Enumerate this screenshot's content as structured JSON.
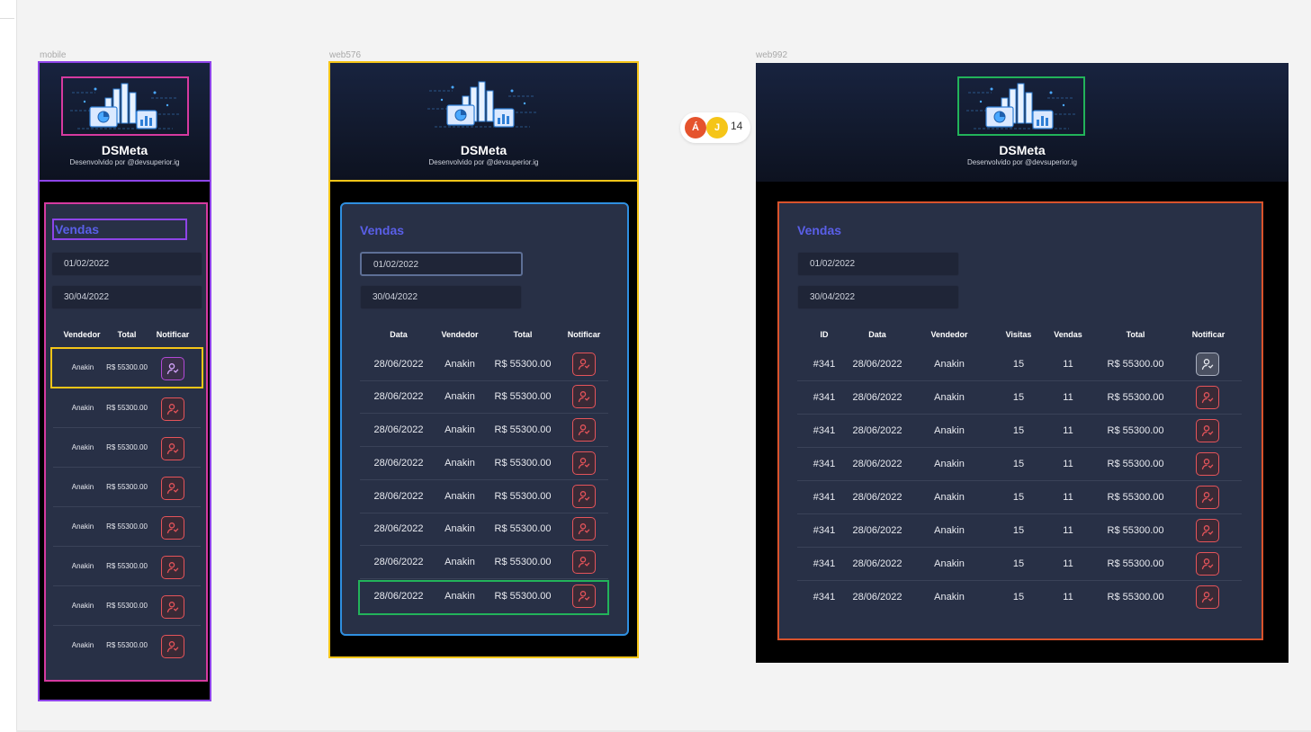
{
  "frames": {
    "mobile_label": "mobile",
    "web576_label": "web576",
    "web992_label": "web992"
  },
  "brand": {
    "title": "DSMeta",
    "subtitle": "Desenvolvido por @devsuperior.ig"
  },
  "sales": {
    "title": "Vendas",
    "date_min": "01/02/2022",
    "date_max": "30/04/2022"
  },
  "columns": {
    "id": "ID",
    "date": "Data",
    "seller": "Vendedor",
    "visits": "Visitas",
    "deals": "Vendas",
    "total": "Total",
    "notify": "Notificar"
  },
  "mobile_rows": [
    {
      "seller": "Anakin",
      "total": "R$ 55300.00"
    },
    {
      "seller": "Anakin",
      "total": "R$ 55300.00"
    },
    {
      "seller": "Anakin",
      "total": "R$ 55300.00"
    },
    {
      "seller": "Anakin",
      "total": "R$ 55300.00"
    },
    {
      "seller": "Anakin",
      "total": "R$ 55300.00"
    },
    {
      "seller": "Anakin",
      "total": "R$ 55300.00"
    },
    {
      "seller": "Anakin",
      "total": "R$ 55300.00"
    },
    {
      "seller": "Anakin",
      "total": "R$ 55300.00"
    }
  ],
  "web576_rows": [
    {
      "date": "28/06/2022",
      "seller": "Anakin",
      "total": "R$ 55300.00"
    },
    {
      "date": "28/06/2022",
      "seller": "Anakin",
      "total": "R$ 55300.00"
    },
    {
      "date": "28/06/2022",
      "seller": "Anakin",
      "total": "R$ 55300.00"
    },
    {
      "date": "28/06/2022",
      "seller": "Anakin",
      "total": "R$ 55300.00"
    },
    {
      "date": "28/06/2022",
      "seller": "Anakin",
      "total": "R$ 55300.00"
    },
    {
      "date": "28/06/2022",
      "seller": "Anakin",
      "total": "R$ 55300.00"
    },
    {
      "date": "28/06/2022",
      "seller": "Anakin",
      "total": "R$ 55300.00"
    },
    {
      "date": "28/06/2022",
      "seller": "Anakin",
      "total": "R$ 55300.00"
    }
  ],
  "web992_rows": [
    {
      "id": "#341",
      "date": "28/06/2022",
      "seller": "Anakin",
      "visits": "15",
      "deals": "11",
      "total": "R$ 55300.00"
    },
    {
      "id": "#341",
      "date": "28/06/2022",
      "seller": "Anakin",
      "visits": "15",
      "deals": "11",
      "total": "R$ 55300.00"
    },
    {
      "id": "#341",
      "date": "28/06/2022",
      "seller": "Anakin",
      "visits": "15",
      "deals": "11",
      "total": "R$ 55300.00"
    },
    {
      "id": "#341",
      "date": "28/06/2022",
      "seller": "Anakin",
      "visits": "15",
      "deals": "11",
      "total": "R$ 55300.00"
    },
    {
      "id": "#341",
      "date": "28/06/2022",
      "seller": "Anakin",
      "visits": "15",
      "deals": "11",
      "total": "R$ 55300.00"
    },
    {
      "id": "#341",
      "date": "28/06/2022",
      "seller": "Anakin",
      "visits": "15",
      "deals": "11",
      "total": "R$ 55300.00"
    },
    {
      "id": "#341",
      "date": "28/06/2022",
      "seller": "Anakin",
      "visits": "15",
      "deals": "11",
      "total": "R$ 55300.00"
    },
    {
      "id": "#341",
      "date": "28/06/2022",
      "seller": "Anakin",
      "visits": "15",
      "deals": "11",
      "total": "R$ 55300.00"
    }
  ],
  "collaborators": {
    "avatars": [
      {
        "initial": "Á",
        "color": "#e5532d"
      },
      {
        "initial": "J",
        "color": "#f5c518"
      }
    ],
    "count": "14"
  },
  "colors": {
    "accent": "#5a5fe8",
    "notify_red": "#e5545a",
    "card_bg": "#283046",
    "selection_purple": "#8e44e8",
    "selection_magenta": "#d63aa0",
    "selection_yellow": "#f5c518",
    "selection_blue": "#2f8fe0",
    "selection_green": "#22b35a",
    "selection_orange": "#d9532c"
  },
  "icons": {
    "logo": "dashboard-illustration-icon",
    "notify": "user-notify-icon"
  }
}
